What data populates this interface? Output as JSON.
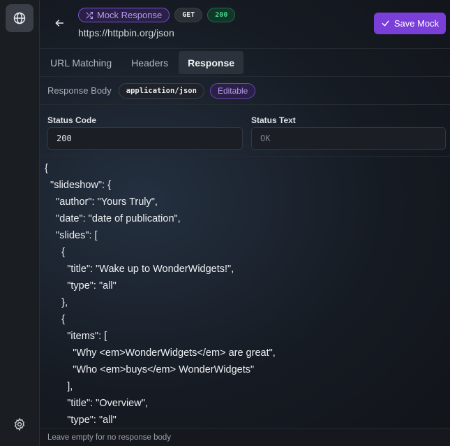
{
  "colors": {
    "accent": "#7a3fd9",
    "status_ok": "#3ed68a",
    "mock_badge": "#b799f5"
  },
  "header": {
    "mock_badge": "Mock Response",
    "method": "GET",
    "status": "200",
    "url": "https://httpbin.org/json",
    "save_label": "Save Mock"
  },
  "tabs": [
    {
      "label": "URL Matching",
      "active": false
    },
    {
      "label": "Headers",
      "active": false
    },
    {
      "label": "Response",
      "active": true
    }
  ],
  "response": {
    "body_label": "Response Body",
    "content_type": "application/json",
    "editable_badge": "Editable",
    "status_code_label": "Status Code",
    "status_code_value": "200",
    "status_text_label": "Status Text",
    "status_text_placeholder": "OK"
  },
  "code_lines": [
    "{",
    "  \"slideshow\": {",
    "    \"author\": \"Yours Truly\",",
    "    \"date\": \"date of publication\",",
    "    \"slides\": [",
    "      {",
    "        \"title\": \"Wake up to WonderWidgets!\",",
    "        \"type\": \"all\"",
    "      },",
    "      {",
    "        \"items\": [",
    "          \"Why <em>WonderWidgets</em> are great\",",
    "          \"Who <em>buys</em> WonderWidgets\"",
    "        ],",
    "        \"title\": \"Overview\",",
    "        \"type\": \"all\""
  ],
  "footer_hint": "Leave empty for no response body",
  "icons": {
    "rail_top": "globe-icon",
    "rail_bottom": "settings-gear-icon",
    "back": "arrow-left-icon",
    "mock": "shuffle-icon",
    "save": "check-icon"
  }
}
